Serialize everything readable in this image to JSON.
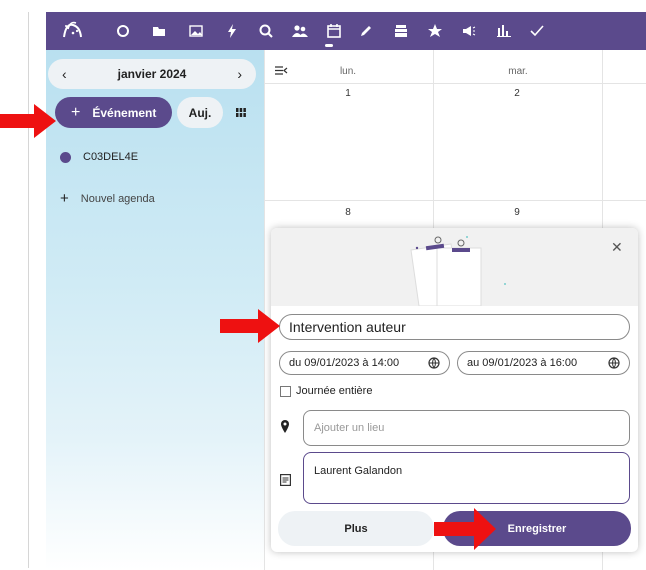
{
  "colors": {
    "brand": "#5b4a8c",
    "annotation_arrow": "#ee1111",
    "sidebar_bg": "#b9e0f0"
  },
  "toolbar": {
    "icons": [
      "app-logo-icon",
      "circle-icon",
      "folder-icon",
      "image-icon",
      "bolt-icon",
      "search-icon",
      "contacts-icon",
      "calendar-icon",
      "pencil-icon",
      "stack-icon",
      "star-icon",
      "megaphone-icon",
      "bar-chart-icon",
      "check-icon"
    ],
    "active": "calendar-icon"
  },
  "sidebar": {
    "month_label": "janvier 2024",
    "prev": "‹",
    "next": "›",
    "new_event_label": "Événement",
    "today_label": "Auj.",
    "calendars": [
      {
        "name": "C03DEL4E",
        "color": "#5b4a8c"
      }
    ],
    "new_calendar_label": "Nouvel agenda"
  },
  "calendar": {
    "day_names": [
      "lun.",
      "mar."
    ],
    "week1": [
      "1",
      "2"
    ],
    "week2": [
      "8",
      "9"
    ]
  },
  "event_popup": {
    "title_value": "Intervention auteur",
    "start": "du 09/01/2023 à 14:00",
    "end": "au 09/01/2023 à 16:00",
    "all_day_label": "Journée entière",
    "all_day_checked": false,
    "location_placeholder": "Ajouter un lieu",
    "notes_value": "Laurent Galandon",
    "more_label": "Plus",
    "save_label": "Enregistrer"
  }
}
